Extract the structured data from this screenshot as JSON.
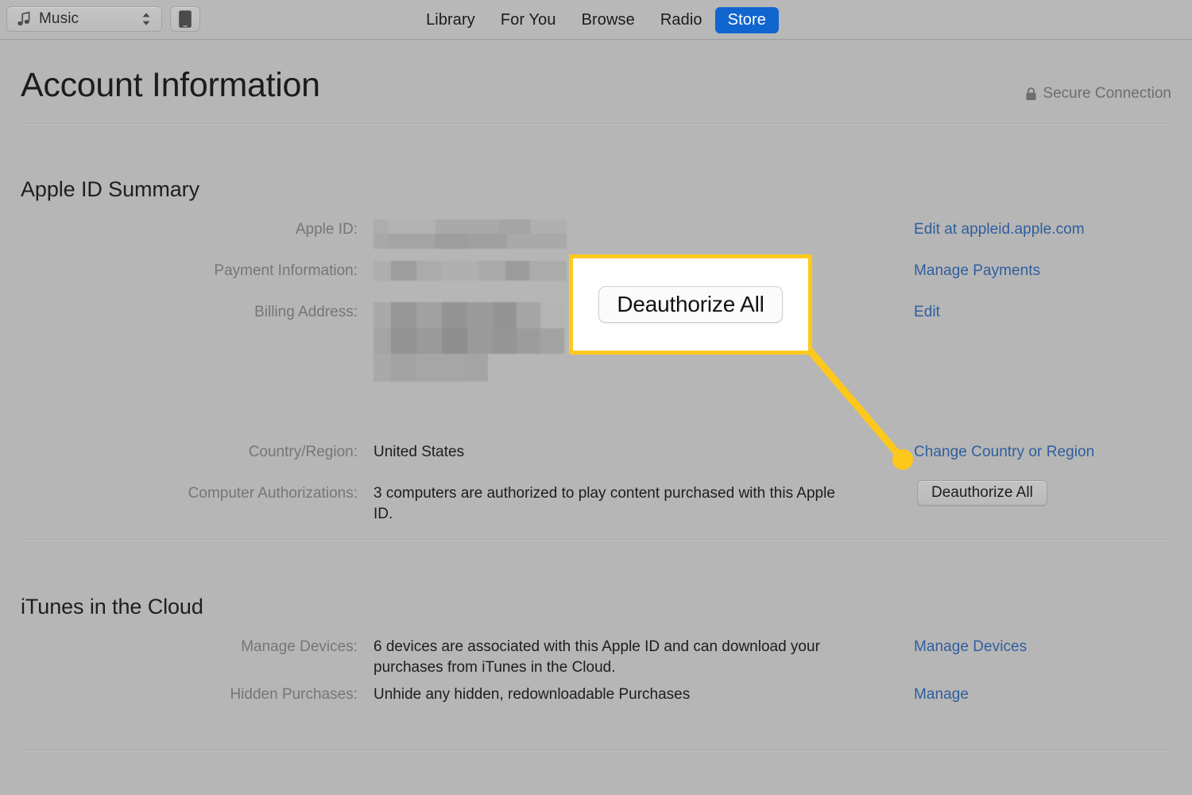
{
  "toolbar": {
    "source_selector": {
      "label": "Music",
      "icon": "music-note-icon",
      "chevron_icon": "chevron-up-down-icon"
    },
    "device_button": {
      "icon": "device-ipad-icon"
    },
    "tabs": [
      {
        "label": "Library",
        "selected": false
      },
      {
        "label": "For You",
        "selected": false
      },
      {
        "label": "Browse",
        "selected": false
      },
      {
        "label": "Radio",
        "selected": false
      },
      {
        "label": "Store",
        "selected": true
      }
    ],
    "selected_tab_color": "#1165ce"
  },
  "header": {
    "title": "Account Information",
    "secure_label": "Secure Connection",
    "secure_icon": "lock-icon"
  },
  "sections": {
    "apple_id_summary": {
      "title": "Apple ID Summary",
      "rows": [
        {
          "label": "Apple ID:",
          "value": "",
          "redacted": true,
          "action": "Edit at appleid.apple.com",
          "action_type": "link"
        },
        {
          "label": "Payment Information:",
          "value": "",
          "redacted": true,
          "action": "Manage Payments",
          "action_type": "link"
        },
        {
          "label": "Billing Address:",
          "value": "",
          "redacted": true,
          "action": "Edit",
          "action_type": "link"
        },
        {
          "label": "Country/Region:",
          "value": "United States",
          "redacted": false,
          "action": "Change Country or Region",
          "action_type": "link"
        },
        {
          "label": "Computer Authorizations:",
          "value": "3 computers are authorized to play content purchased with this Apple ID.",
          "redacted": false,
          "action": "Deauthorize All",
          "action_type": "button"
        }
      ]
    },
    "itunes_in_the_cloud": {
      "title": "iTunes in the Cloud",
      "rows": [
        {
          "label": "Manage Devices:",
          "value": "6 devices are associated with this Apple ID and can download your purchases from iTunes in the Cloud.",
          "action": "Manage Devices",
          "action_type": "link"
        },
        {
          "label": "Hidden Purchases:",
          "value": "Unhide any hidden, redownloadable Purchases",
          "action": "Manage",
          "action_type": "link"
        }
      ]
    }
  },
  "annotation_callout": {
    "magnified_label": "Deauthorize All",
    "highlight_color": "#ffc81c",
    "box_fill": "#ffffff"
  },
  "colors": {
    "window_background": "#b6b6b6",
    "toolbar_background": "#b8b8b8",
    "link_blue": "#2f5e9e",
    "label_gray": "#767676",
    "text_dark": "#1d1d1d"
  }
}
